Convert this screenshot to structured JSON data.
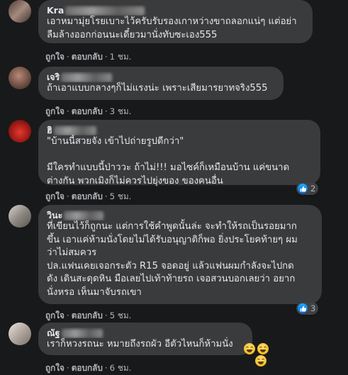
{
  "comments": [
    {
      "author": "Kra",
      "text": "เอาหมามุ่ยโรยเบาะไว้ครับรับรองเกาหว่างขาถลอกแน่ๆ แต่อย่า\nลืมล้างออกก่อนนะเดี๋ยวมานั่งทับซะเอง555",
      "like": "ถูกใจ",
      "reply": "ตอบกลับ",
      "time": "1 ชม."
    },
    {
      "author": "เจริ",
      "text": "ถ้าเอาแบบกลางๆก็ไม่แรงน่ะ เพราะเสียมารยาทจริง555",
      "like": "ถูกใจ",
      "reply": "ตอบกลับ",
      "time": "3 ชม."
    },
    {
      "author": "ฮิ",
      "text": "\"บ้านนี้สวยจัง เข้าไปถ่ายรูปดีกว่า\"\n\nมีใครทำแบบนี้ป่าววะ ถ้าไม่!!! มอไซค์ก็เหมือนบ้าน แค่ขนาด\nต่างกัน พวกเมิงก็ไม่ควรไปยุ่งของ ของคนอื่น",
      "like": "ถูกใจ",
      "reply": "ตอบกลับ",
      "time": "5 ชม.",
      "reaction_count": "2"
    },
    {
      "author": "วินะ",
      "text": "ที่เขียนไว้ก็ถูกนะ แต่การใช้คำพูดนั้นล่ะ จะทำให้รถเป็นรอยมาก\nขึ้น เอาแค่ห้ามนั่งโดยไม่ได้รับอนุญาติก็พอ ยิ่งประโยคท้ายๆ ผม\nว่าไม่สมควร\nปล.แฟนเคยเจอกระตัว R15 จอดอยู่ แล้วแฟนผมกำลังจะไปกด\nดัง เดินสะดุดหิน มือเลยไปเท้าท้ายรถ เจอสวนบอกเลยว่า อยาก\nนั่งหรอ เห็นมาจับรถเขา",
      "like": "ถูกใจ",
      "reply": "ตอบกลับ",
      "time": "5 ชม.",
      "reaction_count": "3"
    },
    {
      "author": "ณัฐ",
      "text": "เราก็หวงรถนะ หมายถึงรถผัว อีตัวไหนก็ห้ามนั่ง",
      "like": "ถูกใจ",
      "reply": "ตอบกลับ",
      "time": "6 ชม."
    }
  ],
  "colors": {
    "background": "#18191a",
    "bubble": "#3a3b3c",
    "text": "#e4e6eb",
    "secondary_text": "#b0b3b8",
    "like_blue": "#1877f2"
  },
  "icons": [
    "like-icon",
    "laughing-emoji"
  ]
}
